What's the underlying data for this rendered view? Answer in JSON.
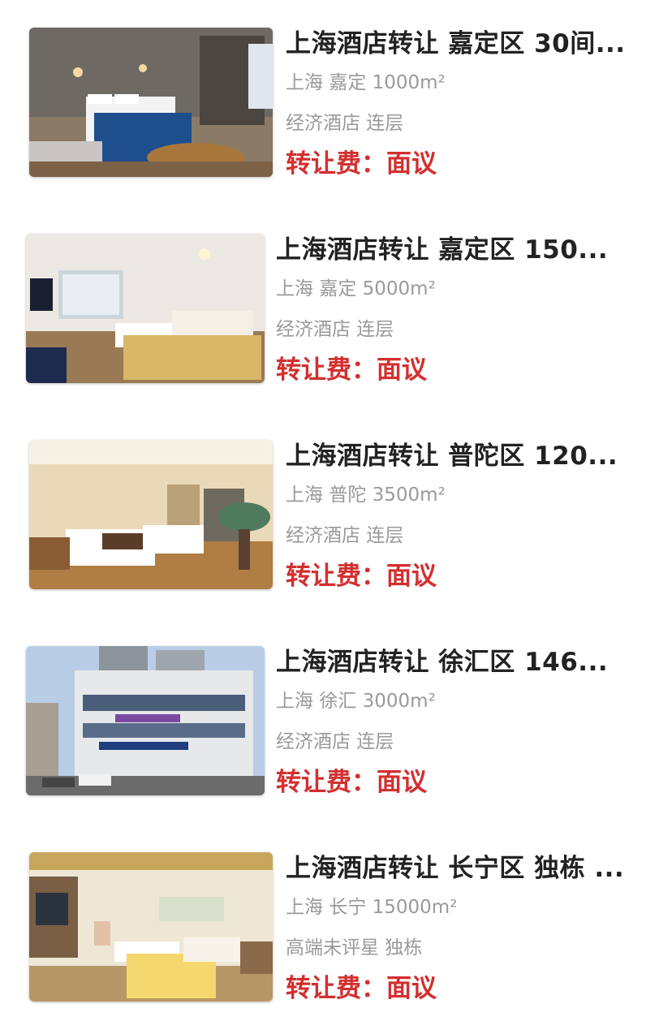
{
  "listings": [
    {
      "title": "上海酒店转让 嘉定区 30间...",
      "city": "上海",
      "district": "嘉定",
      "area": "1000m²",
      "tags": "经济酒店 连层",
      "price_label": "转让费：",
      "price_value": "面议",
      "image_icon": "hotel-room-photo"
    },
    {
      "title": "上海酒店转让 嘉定区 150...",
      "city": "上海",
      "district": "嘉定",
      "area": "5000m²",
      "tags": "经济酒店 连层",
      "price_label": "转让费：",
      "price_value": "面议",
      "image_icon": "hotel-room-photo"
    },
    {
      "title": "上海酒店转让 普陀区 120...",
      "city": "上海",
      "district": "普陀",
      "area": "3500m²",
      "tags": "经济酒店 连层",
      "price_label": "转让费：",
      "price_value": "面议",
      "image_icon": "hotel-room-photo"
    },
    {
      "title": "上海酒店转让 徐汇区 146...",
      "city": "上海",
      "district": "徐汇",
      "area": "3000m²",
      "tags": "经济酒店 连层",
      "price_label": "转让费：",
      "price_value": "面议",
      "image_icon": "hotel-building-photo"
    },
    {
      "title": "上海酒店转让 长宁区 独栋 ...",
      "city": "上海",
      "district": "长宁",
      "area": "15000m²",
      "tags": "高端未评星 独栋",
      "price_label": "转让费：",
      "price_value": "面议",
      "image_icon": "hotel-room-photo"
    }
  ],
  "colors": {
    "title": "#222222",
    "meta": "#9a9a9a",
    "price": "#d32f2f"
  }
}
